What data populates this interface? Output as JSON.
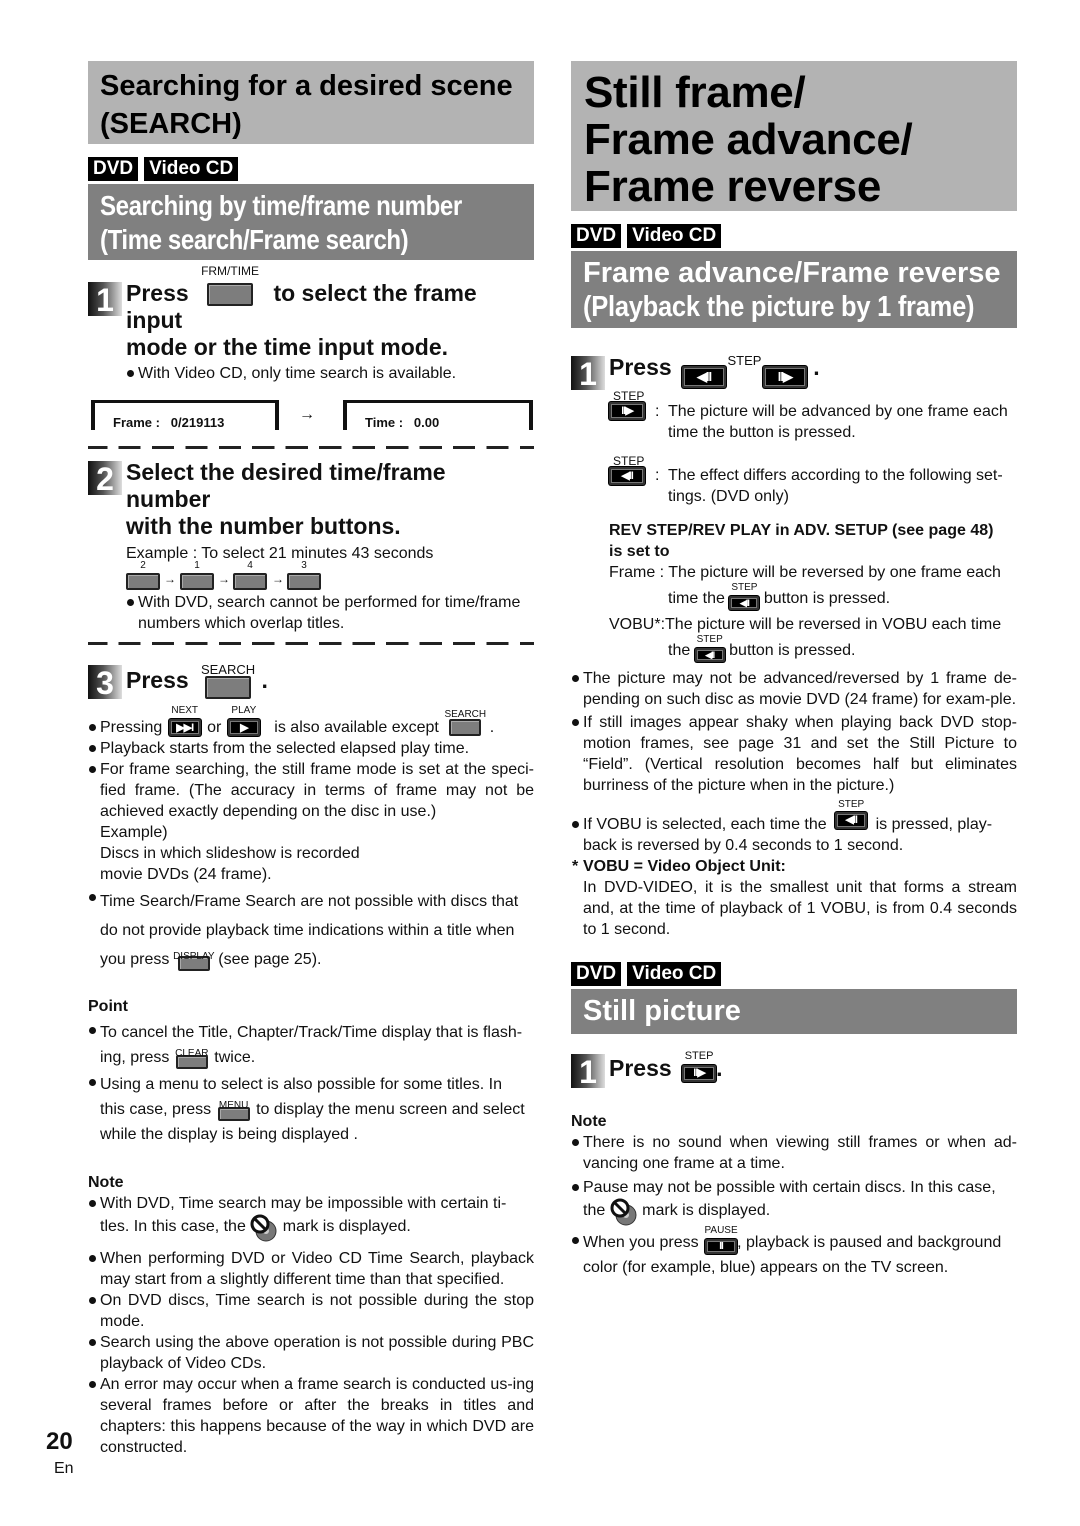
{
  "left": {
    "main_title_line1": "Searching for a desired scene",
    "main_title_line2": "(SEARCH)",
    "badges": [
      "DVD",
      "Video CD"
    ],
    "sub_title_line1": "Searching by time/frame number",
    "sub_title_line2": "(Time search/Frame search)",
    "step1": {
      "num": "1",
      "button_label": "FRM/TIME",
      "text_a": "Press",
      "text_b": "to select the frame input",
      "text_c": "mode or the time input mode.",
      "bullet": "With Video CD, only time search is available.",
      "frame_display": "Frame :   0/219113",
      "arrow": "→",
      "time_display": "Time :   0.00"
    },
    "step2": {
      "num": "2",
      "text_a": "Select the desired time/frame number",
      "text_b": "with the number buttons.",
      "example": "Example : To select 21 minutes 43 seconds",
      "digits": [
        "2",
        "1",
        "4",
        "3"
      ],
      "arrow": "→",
      "bullet_a": "With DVD, search cannot be performed for time/frame",
      "bullet_b": "numbers which overlap titles."
    },
    "step3": {
      "num": "3",
      "text": "Press",
      "button_label": "SEARCH",
      "period": ".",
      "bullets": {
        "pressing_a": "Pressing",
        "next_label": "NEXT",
        "or": "or",
        "play_label": "PLAY",
        "pressing_b": "is also available except",
        "search_label": "SEARCH",
        "pressing_c": ".",
        "playback": "Playback starts from the selected elapsed play time.",
        "frame_search": "For frame searching, the still frame mode is set at the speci-fied frame. (The accuracy in terms of frame may not be achieved exactly depending on the disc in use.)",
        "example": "Example)",
        "example_line1": "Discs in which slideshow is recorded",
        "example_line2": "movie DVDs (24 frame).",
        "time_search_a": "Time Search/Frame Search are not possible with discs that",
        "time_search_b": "do not provide playback time indications within a title when",
        "time_search_c": "you press",
        "display_label": "DISPLAY",
        "time_search_d": "(see page 25)."
      }
    },
    "point": {
      "heading": "Point",
      "cancel_a": "To cancel the Title, Chapter/Track/Time display that is flash-",
      "cancel_b": "ing, press",
      "clear_label": "CLEAR",
      "cancel_c": "twice.",
      "menu_a": "Using a menu to select is also possible for some titles. In",
      "menu_b": "this case, press",
      "menu_label": "MENU",
      "menu_c": "to display the menu screen and select",
      "menu_d": "while the display is being displayed ."
    },
    "note": {
      "heading": "Note",
      "items": [
        {
          "a": "With DVD, Time search may be impossible with certain ti-",
          "b": "tles. In this case, the",
          "c": "mark is displayed."
        },
        "When performing DVD or Video CD Time Search, playback may start from a slightly different time than that specified.",
        "On DVD discs, Time search is not possible during the stop mode.",
        "Search using the above operation is not possible during PBC playback of Video CDs.",
        "An error may occur when a frame search is conducted us-ing several frames before or after the breaks in titles and chapters: this happens because of the way in which DVD are constructed."
      ]
    }
  },
  "right": {
    "main_title_lines": [
      "Still frame/",
      "Frame advance/",
      "Frame reverse"
    ],
    "badges": [
      "DVD",
      "Video CD"
    ],
    "sub_title_line1": "Frame advance/Frame reverse",
    "sub_title_line2": "(Playback the picture by 1 frame)",
    "step1": {
      "num": "1",
      "text": "Press",
      "step_label": "STEP",
      "period": ".",
      "rev_glyph": "◀II",
      "fwd_glyph": "II▶",
      "fwd_desc_a": "The picture will be advanced by one frame each",
      "fwd_desc_b": "time the button is pressed.",
      "rev_desc_a": "The effect differs according to the following set-",
      "rev_desc_b": "tings. (DVD only)",
      "colon": ":",
      "setting_head_a": "REV STEP/REV PLAY in ADV. SETUP (see page 48)",
      "setting_head_b": "is set to",
      "frame_a": "Frame : The picture will be reversed by one frame each",
      "frame_b": "time the",
      "frame_c": "button is pressed.",
      "vobu_a": "VOBU*:The picture will be reversed in VOBU each time",
      "vobu_b": "the",
      "vobu_c": "button is pressed."
    },
    "bullets": {
      "advance": "The picture may not be advanced/reversed by 1 frame de-pending on such disc as movie DVD (24 frame) for exam-ple.",
      "shaky": "If still images appear shaky when playing back DVD stop-motion frames, see page 31 and set the Still Picture to “Field”. (Vertical resolution becomes half but eliminates burriness of the picture when in the picture.)",
      "vobu_a": "If VOBU is selected, each time the",
      "vobu_b": "is pressed, play-",
      "vobu_c": "back is reversed by 0.4 seconds to 1 second."
    },
    "vobu_def": {
      "star": "*",
      "head": "VOBU = Video Object Unit:",
      "text": "In DVD-VIDEO, it is the smallest unit that forms a stream and, at the time of playback of 1 VOBU, is from 0.4 seconds to 1 second."
    },
    "still": {
      "badges": [
        "DVD",
        "Video CD"
      ],
      "title": "Still picture",
      "step_num": "1",
      "step_text": "Press",
      "step_label": "STEP",
      "period": "."
    },
    "note": {
      "heading": "Note",
      "sound": "There is no sound when viewing still frames or when ad-vancing one frame at a time.",
      "pause_a": "Pause may not be possible with certain discs. In this  case,",
      "pause_b": "the",
      "pause_c": "mark is displayed.",
      "press_a": "When you press",
      "pause_label": "PAUSE",
      "press_b": ", playback is paused and background",
      "press_c": "color (for example, blue) appears on the TV screen."
    }
  },
  "footer": {
    "page_number": "20",
    "language": "En"
  }
}
